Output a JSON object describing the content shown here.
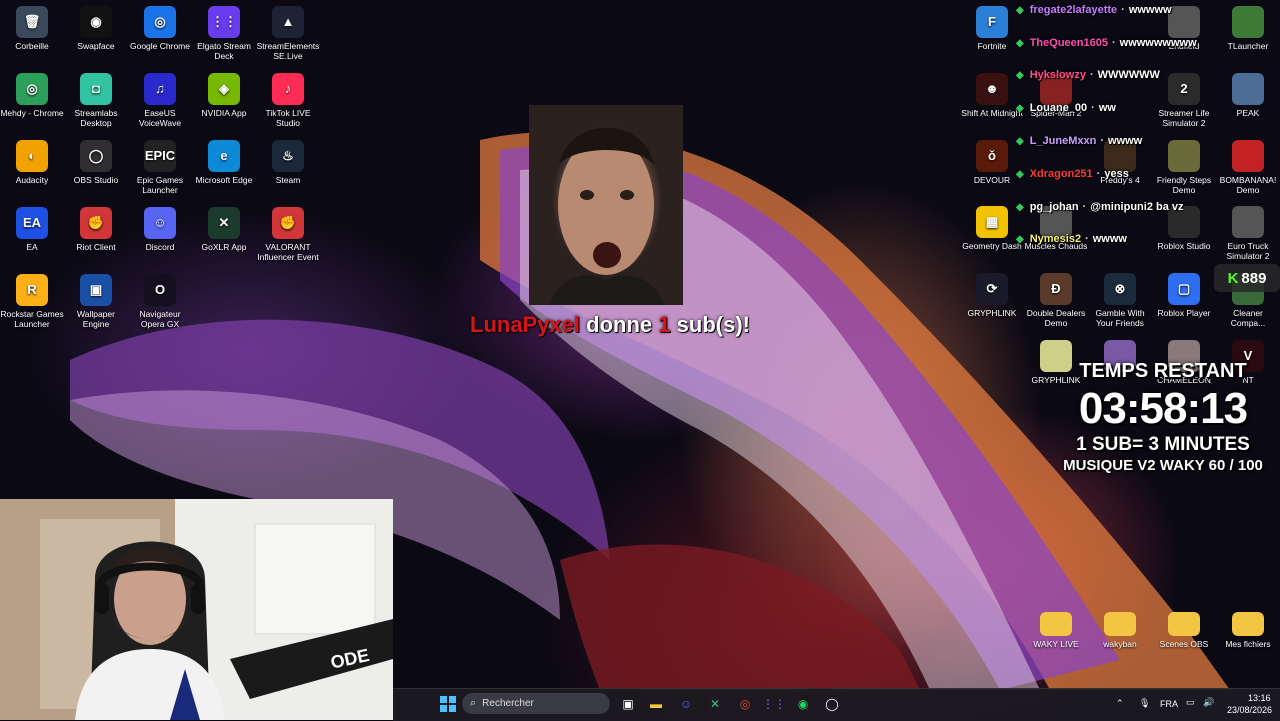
{
  "desktop_icons": [
    {
      "label": "Corbeille",
      "glyph": "🗑",
      "color": "#3a4a5c"
    },
    {
      "label": "Swapface",
      "glyph": "◉",
      "color": "#111111"
    },
    {
      "label": "Google Chrome",
      "glyph": "◎",
      "color": "#1a73e8"
    },
    {
      "label": "Elgato Stream Deck",
      "glyph": "⋮⋮",
      "color": "#6a3cf0"
    },
    {
      "label": "StreamElements SE.Live",
      "glyph": "▲",
      "color": "#1e2235"
    },
    {
      "label": "Mehdy - Chrome",
      "glyph": "◎",
      "color": "#2ca05a"
    },
    {
      "label": "Streamlabs Desktop",
      "glyph": "◘",
      "color": "#31c3a2"
    },
    {
      "label": "EaseUS VoiceWave",
      "glyph": "♫",
      "color": "#2a2acc"
    },
    {
      "label": "NVIDIA App",
      "glyph": "◈",
      "color": "#76b900"
    },
    {
      "label": "TikTok LIVE Studio",
      "glyph": "♪",
      "color": "#fe2c55"
    },
    {
      "label": "Audacity",
      "glyph": "◐",
      "color": "#f2a200"
    },
    {
      "label": "OBS Studio",
      "glyph": "◯",
      "color": "#302e31"
    },
    {
      "label": "Epic Games Launcher",
      "glyph": "EPIC",
      "color": "#222222"
    },
    {
      "label": "Microsoft Edge",
      "glyph": "e",
      "color": "#0c8ad8"
    },
    {
      "label": "Steam",
      "glyph": "♨",
      "color": "#1b2838"
    },
    {
      "label": "EA",
      "glyph": "EA",
      "color": "#1e50e6"
    },
    {
      "label": "Riot Client",
      "glyph": "✊",
      "color": "#d13639"
    },
    {
      "label": "Discord",
      "glyph": "☺",
      "color": "#5865f2"
    },
    {
      "label": "GoXLR App",
      "glyph": "✕",
      "color": "#1b3b2e"
    },
    {
      "label": "VALORANT Influencer Event",
      "glyph": "✊",
      "color": "#d13639"
    },
    {
      "label": "Rockstar Games Launcher",
      "glyph": "R",
      "color": "#fcaf17"
    },
    {
      "label": "Wallpaper Engine",
      "glyph": "▣",
      "color": "#1a4fa6"
    },
    {
      "label": "Navigateur Opera GX",
      "glyph": "O",
      "color": "#15101f"
    }
  ],
  "right_icons": [
    {
      "label": "Fortnite",
      "glyph": "F",
      "color": "#2b7fd6"
    },
    {
      "label": "Endfield",
      "glyph": "",
      "color": "#555555"
    },
    {
      "label": "TLauncher",
      "glyph": "",
      "color": "#3d7a36"
    },
    {
      "label": "Shift At Midnight",
      "glyph": "☻",
      "color": "#3a1010"
    },
    {
      "label": "Spider-Man 2",
      "glyph": "",
      "color": "#882222"
    },
    {
      "label": "Streamer Life Simulator 2",
      "glyph": "2",
      "color": "#2b2b2b"
    },
    {
      "label": "PEAK",
      "glyph": "",
      "color": "#4c6e96"
    },
    {
      "label": "DEVOUR",
      "glyph": "ǒ",
      "color": "#5a1a0a"
    },
    {
      "label": "Freddy's 4",
      "glyph": "",
      "color": "#3c2a1a"
    },
    {
      "label": "Friendly Steps Demo",
      "glyph": "",
      "color": "#6a6a3a"
    },
    {
      "label": "BOMBANANA! Demo",
      "glyph": "",
      "color": "#c22222"
    },
    {
      "label": "Geometry Dash",
      "glyph": "▦",
      "color": "#f2c200"
    },
    {
      "label": "Muscles Chauds",
      "glyph": "",
      "color": "#555555"
    },
    {
      "label": "Roblox Studio",
      "glyph": "",
      "color": "#2a2a2a"
    },
    {
      "label": "Euro Truck Simulator 2",
      "glyph": "",
      "color": "#555555"
    },
    {
      "label": "GRYPHLINK",
      "glyph": "⟳",
      "color": "#1a1a2a"
    },
    {
      "label": "Double Dealers Demo",
      "glyph": "Ð",
      "color": "#5a3a2a"
    },
    {
      "label": "Gamble With Your Friends",
      "glyph": "⊗",
      "color": "#1c2b3c"
    },
    {
      "label": "Roblox Player",
      "glyph": "▢",
      "color": "#2e6ff2"
    },
    {
      "label": "Cleaner Compa...",
      "glyph": "",
      "color": "#3a6a3a"
    },
    {
      "label": "GRYPHLINK",
      "glyph": "",
      "color": "#cfcf8a"
    },
    {
      "label": "",
      "glyph": "",
      "color": "#7a5aa8"
    },
    {
      "label": "CHAMELEON",
      "glyph": "",
      "color": "#8a7a7a"
    },
    {
      "label": "NT",
      "glyph": "V",
      "color": "#2a0a10"
    }
  ],
  "folders": [
    {
      "label": "WAKY LIVE"
    },
    {
      "label": "wakyban"
    },
    {
      "label": "Scenes OBS"
    },
    {
      "label": "Mes fichiers"
    }
  ],
  "alert": {
    "username": "LunaPyxel",
    "text_a": "donne",
    "count": "1",
    "text_b": "sub(s)!"
  },
  "chat": [
    {
      "user": "fregate2lafayette",
      "user_color": "#c57bff",
      "msg": "wwwww"
    },
    {
      "user": "TheQueen1605",
      "user_color": "#ff4fb0",
      "msg": "wwwwwwwww"
    },
    {
      "user": "Hykslowzy",
      "user_color": "#ff4f8a",
      "msg": "WWWWWW"
    },
    {
      "user": "Louane_00",
      "user_color": "#ffffff",
      "msg": "ww"
    },
    {
      "user": "L_JuneMxxn",
      "user_color": "#c9a0ff",
      "msg": "wwww"
    },
    {
      "user": "Xdragon251",
      "user_color": "#ff3b3b",
      "msg": "yess"
    },
    {
      "user": "pg_johan",
      "user_color": "#ffffff",
      "msg": "@minipuni2 ba vz"
    },
    {
      "user": "Nymesis2",
      "user_color": "#f5f26a",
      "msg": "wwww"
    }
  ],
  "counter": {
    "prefix": "K",
    "value": "889"
  },
  "timer": {
    "title": "TEMPS RESTANT",
    "time": "03:58:13",
    "rate": "1 SUB= 3 MINUTES",
    "music": "MUSIQUE V2 WAKY 60 / 100"
  },
  "taskbar": {
    "search_placeholder": "Rechercher",
    "lang": "FRA",
    "time": "13:16",
    "date": "23/08/2026"
  },
  "colors": {
    "accent_red": "#d4161b",
    "chat_badge": "#34c759",
    "taskbar": "#1c1a22"
  }
}
